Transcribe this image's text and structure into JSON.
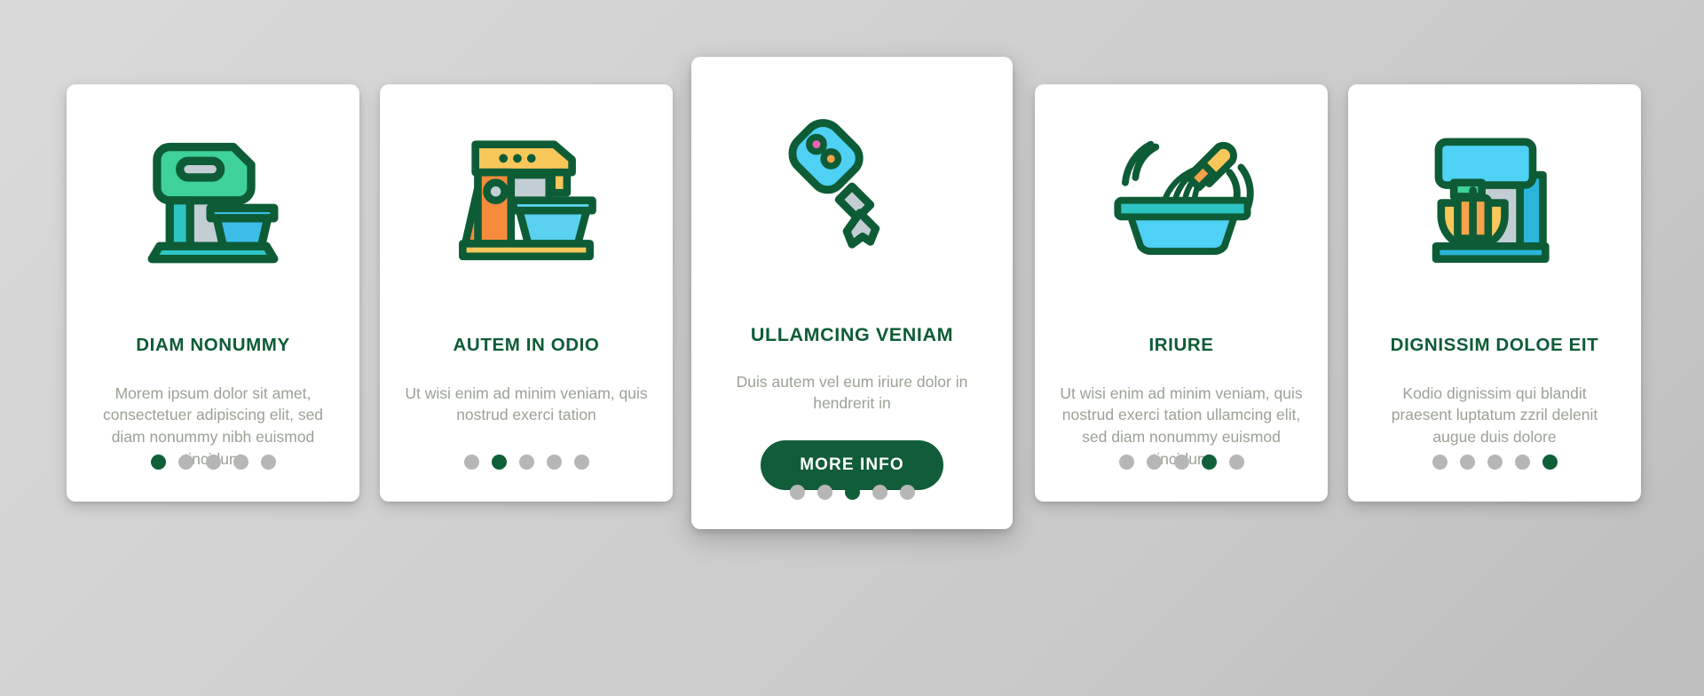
{
  "page": {
    "background_color": "#d2d2d2",
    "accent_green": "#0d5c36",
    "button_green": "#115c39",
    "body_text_color": "#9aa295",
    "dot_inactive_color": "#b6b6b6",
    "dot_active_color": "#0f6038"
  },
  "cards": [
    {
      "id": "card-1",
      "icon_name": "hand-mixer-icon",
      "title": "DIAM NONUMMY",
      "body": "Morem ipsum dolor sit amet, consectetuer adipiscing elit, sed diam nonummy nibh euismod tincidunt",
      "featured": false,
      "dots_total": 5,
      "dot_active_index": 1,
      "has_button": false
    },
    {
      "id": "card-2",
      "icon_name": "stand-mixer-icon",
      "title": "AUTEM IN ODIO",
      "body": "Ut wisi enim ad minim veniam, quis nostrud exerci tation",
      "featured": false,
      "dots_total": 5,
      "dot_active_index": 2,
      "has_button": false
    },
    {
      "id": "card-3",
      "icon_name": "immersion-blender-icon",
      "title": "ULLAMCING VENIAM",
      "body": "Duis autem vel eum iriure dolor in hendrerit in",
      "featured": true,
      "dots_total": 5,
      "dot_active_index": 3,
      "has_button": true,
      "button_label": "MORE INFO"
    },
    {
      "id": "card-4",
      "icon_name": "whisk-bowl-icon",
      "title": "IRIURE",
      "body": "Ut wisi enim ad minim veniam, quis nostrud exerci tation ullamcing elit, sed diam nonummy euismod tincidunt",
      "featured": false,
      "dots_total": 5,
      "dot_active_index": 4,
      "has_button": false
    },
    {
      "id": "card-5",
      "icon_name": "kitchen-mixer-icon",
      "title": "DIGNISSIM DOLOE EIT",
      "body": "Kodio dignissim qui blandit praesent luptatum zzril delenit augue duis dolore",
      "featured": false,
      "dots_total": 5,
      "dot_active_index": 5,
      "has_button": false
    }
  ]
}
